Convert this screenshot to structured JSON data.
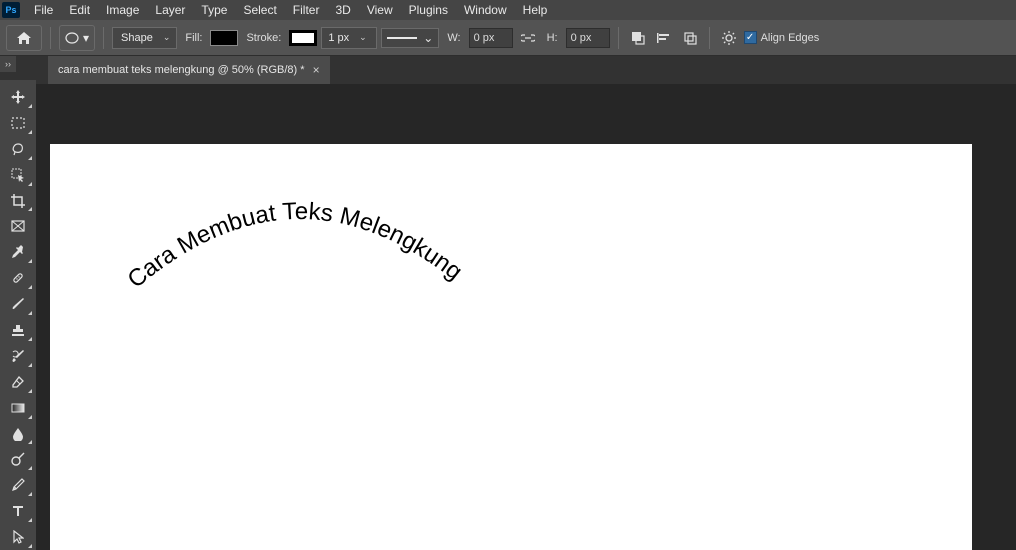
{
  "menu": [
    "File",
    "Edit",
    "Image",
    "Layer",
    "Type",
    "Select",
    "Filter",
    "3D",
    "View",
    "Plugins",
    "Window",
    "Help"
  ],
  "options": {
    "mode_label": "Shape",
    "fill_label": "Fill:",
    "stroke_label": "Stroke:",
    "stroke_width": "1 px",
    "w_label": "W:",
    "w_value": "0 px",
    "h_label": "H:",
    "h_value": "0 px",
    "align_label": "Align Edges"
  },
  "tab": {
    "title": "cara membuat teks melengkung @ 50% (RGB/8) *"
  },
  "canvas": {
    "curved_text": "Cara Membuat Teks Melengkung"
  }
}
